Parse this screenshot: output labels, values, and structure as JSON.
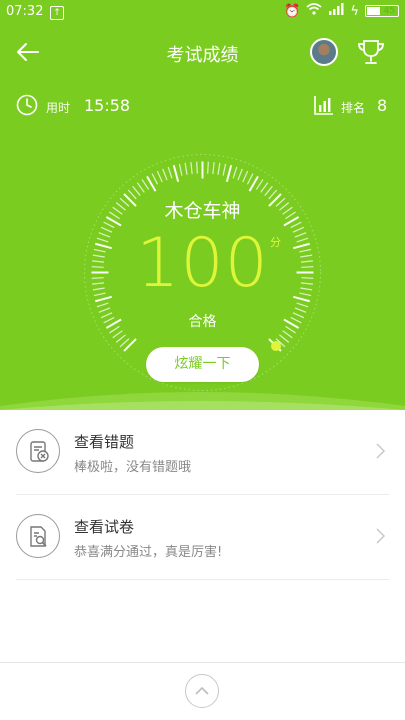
{
  "status_bar": {
    "time": "07:32",
    "battery_level": "45"
  },
  "header": {
    "title": "考试成绩",
    "back_icon": "arrow-left-icon",
    "trophy_icon": "trophy-icon"
  },
  "meta": {
    "time_label": "用时",
    "time_value": "15:58",
    "rank_label": "排名",
    "rank_value": "8"
  },
  "result": {
    "nickname": "木仓车神",
    "score": "100",
    "score_unit": "分",
    "status": "合格",
    "share_button": "炫耀一下",
    "gauge_fraction": 1.0
  },
  "actions": [
    {
      "title": "查看错题",
      "subtitle": "棒极啦，没有错题哦",
      "icon": "wrong-answers-icon"
    },
    {
      "title": "查看试卷",
      "subtitle": "恭喜满分通过，真是厉害!",
      "icon": "review-paper-icon"
    }
  ],
  "colors": {
    "brand_green": "#7bcc20",
    "score_yellow": "#dff53a"
  }
}
